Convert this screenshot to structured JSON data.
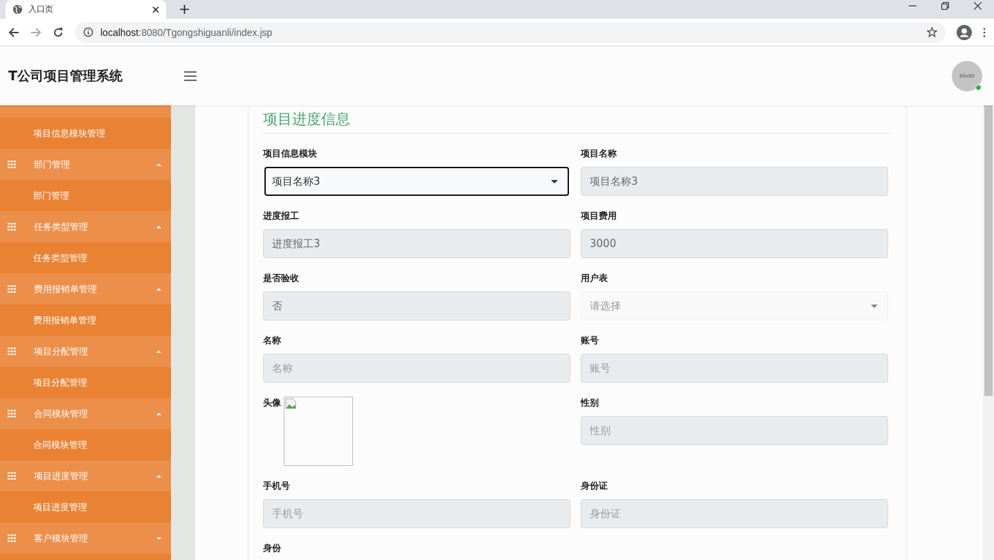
{
  "browser": {
    "tab_title": "入口页",
    "url_host": "localhost",
    "url_rest": ":8080/Tgongshiguanli/index.jsp"
  },
  "header": {
    "title": "T公司项目管理系统",
    "avatar_text": "80x80",
    "online": true
  },
  "sidebar": {
    "groups": [
      {
        "expanded": true,
        "children": [
          {
            "label": "项目信息模块管理"
          }
        ]
      },
      {
        "label": "部门管理",
        "expanded": true,
        "children": [
          {
            "label": "部门管理"
          }
        ]
      },
      {
        "label": "任务类型管理",
        "expanded": true,
        "children": [
          {
            "label": "任务类型管理"
          }
        ]
      },
      {
        "label": "费用报销单管理",
        "expanded": true,
        "children": [
          {
            "label": "费用报销单管理"
          }
        ]
      },
      {
        "label": "项目分配管理",
        "expanded": true,
        "children": [
          {
            "label": "项目分配管理"
          }
        ]
      },
      {
        "label": "合同模块管理",
        "expanded": true,
        "children": [
          {
            "label": "合同模块管理"
          }
        ]
      },
      {
        "label": "项目进度管理",
        "expanded": true,
        "children": [
          {
            "label": "项目进度管理"
          }
        ]
      },
      {
        "label": "客户模块管理",
        "expanded": false
      }
    ]
  },
  "form": {
    "title": "项目进度信息",
    "fields": [
      {
        "kind": "select",
        "label": "项目信息模块",
        "value": "项目名称3",
        "focused": true
      },
      {
        "kind": "input",
        "label": "项目名称",
        "value": "项目名称3"
      },
      {
        "kind": "input",
        "label": "进度报工",
        "value": "进度报工3"
      },
      {
        "kind": "input",
        "label": "项目费用",
        "value": "3000"
      },
      {
        "kind": "input",
        "label": "是否验收",
        "value": "否"
      },
      {
        "kind": "select",
        "label": "用户表",
        "placeholder": "请选择",
        "focused": false
      },
      {
        "kind": "input",
        "label": "名称",
        "placeholder": "名称"
      },
      {
        "kind": "input",
        "label": "账号",
        "placeholder": "账号"
      },
      {
        "kind": "image",
        "label": "头像"
      },
      {
        "kind": "input",
        "label": "性别",
        "placeholder": "性别"
      },
      {
        "kind": "input",
        "label": "手机号",
        "placeholder": "手机号"
      },
      {
        "kind": "input",
        "label": "身份证",
        "placeholder": "身份证"
      },
      {
        "kind": "input",
        "label": "身份"
      }
    ]
  }
}
